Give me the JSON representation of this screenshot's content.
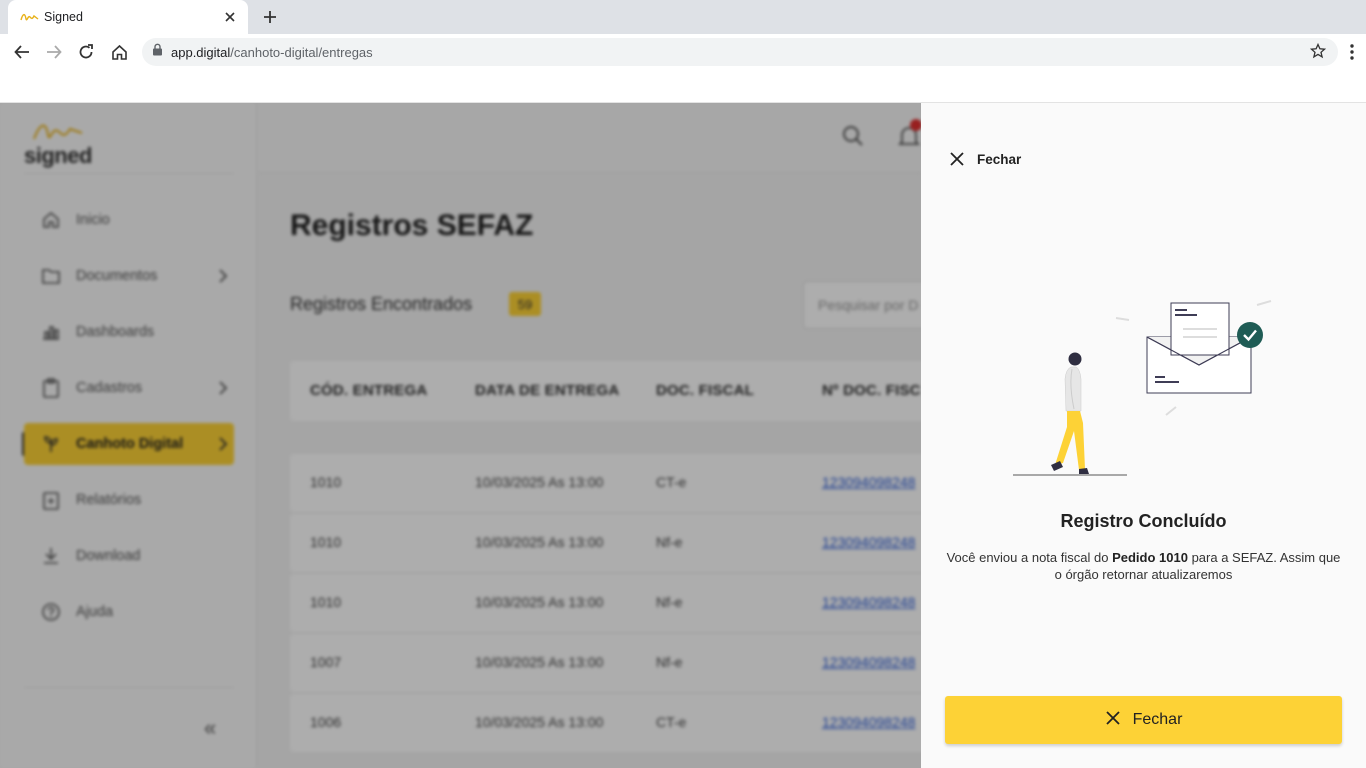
{
  "browser": {
    "tab_title": "Signed",
    "url_host": "app.digital",
    "url_path": "/canhoto-digital/entregas"
  },
  "app": {
    "logo_text": "signed",
    "sidebar": {
      "items": [
        {
          "label": "Inicio",
          "icon": "home-icon"
        },
        {
          "label": "Documentos",
          "icon": "folder-icon"
        },
        {
          "label": "Dashboards",
          "icon": "chart-icon"
        },
        {
          "label": "Cadastros",
          "icon": "clipboard-icon"
        },
        {
          "label": "Canhoto Digital",
          "icon": "plant-icon"
        },
        {
          "label": "Relatórios",
          "icon": "report-icon"
        },
        {
          "label": "Download",
          "icon": "download-icon"
        },
        {
          "label": "Ajuda",
          "icon": "help-icon"
        }
      ],
      "collapse_label": "«"
    },
    "page_title": "Registros SEFAZ",
    "found_label": "Registros Encontrados",
    "found_count": "59",
    "search_placeholder": "Pesquisar por D",
    "table": {
      "headers": [
        "CÓD. ENTREGA",
        "DATA DE ENTREGA",
        "DOC. FISCAL",
        "Nº DOC. FISC"
      ],
      "rows": [
        [
          "1010",
          "10/03/2025 As 13:00",
          "CT-e",
          "123094098248"
        ],
        [
          "1010",
          "10/03/2025 As 13:00",
          "Nf-e",
          "123094098248"
        ],
        [
          "1010",
          "10/03/2025 As 13:00",
          "Nf-e",
          "123094098248"
        ],
        [
          "1007",
          "10/03/2025 As 13:00",
          "Nf-e",
          "123094098248"
        ],
        [
          "1006",
          "10/03/2025 As 13:00",
          "CT-e",
          "123094098248"
        ]
      ]
    }
  },
  "panel": {
    "close_top_label": "Fechar",
    "title": "Registro Concluído",
    "msg_prefix": "Você enviou a nota fiscal do ",
    "msg_bold": "Pedido 1010",
    "msg_suffix": " para a SEFAZ. Assim que o órgão retornar atualizaremos",
    "close_button_label": "Fechar"
  },
  "colors": {
    "accent": "#fdd236",
    "check": "#1f5c55"
  }
}
